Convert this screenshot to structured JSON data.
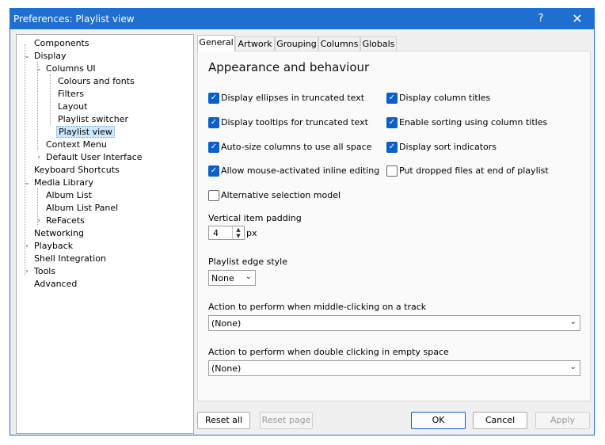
{
  "window": {
    "title": "Preferences: Playlist view",
    "help_glyph": "?",
    "close_glyph": "✕"
  },
  "tree": {
    "items": [
      {
        "label": "Components"
      },
      {
        "label": "Display",
        "expander": "⌄"
      },
      {
        "label": "Columns UI",
        "expander": "⌄"
      },
      {
        "label": "Colours and fonts"
      },
      {
        "label": "Filters"
      },
      {
        "label": "Layout"
      },
      {
        "label": "Playlist switcher"
      },
      {
        "label": "Playlist view",
        "selected": true
      },
      {
        "label": "Context Menu"
      },
      {
        "label": "Default User Interface",
        "expander": "›"
      },
      {
        "label": "Keyboard Shortcuts"
      },
      {
        "label": "Media Library",
        "expander": "⌄"
      },
      {
        "label": "Album List"
      },
      {
        "label": "Album List Panel"
      },
      {
        "label": "ReFacets",
        "expander": "›"
      },
      {
        "label": "Networking"
      },
      {
        "label": "Playback",
        "expander": "›"
      },
      {
        "label": "Shell Integration"
      },
      {
        "label": "Tools",
        "expander": "›"
      },
      {
        "label": "Advanced"
      }
    ]
  },
  "tabs": [
    "General",
    "Artwork",
    "Grouping",
    "Columns",
    "Globals"
  ],
  "panel": {
    "heading": "Appearance and behaviour",
    "checkboxes": {
      "ellipses": {
        "label": "Display ellipses in truncated text",
        "checked": true
      },
      "tooltips": {
        "label": "Display tooltips for truncated text",
        "checked": true
      },
      "autosize": {
        "label": "Auto-size columns to use all space",
        "checked": true
      },
      "inline_edit": {
        "label": "Allow mouse-activated inline editing",
        "checked": true
      },
      "alt_selection": {
        "label": "Alternative selection model",
        "checked": false
      },
      "column_titles": {
        "label": "Display column titles",
        "checked": true
      },
      "sorting": {
        "label": "Enable sorting using column titles",
        "checked": true
      },
      "sort_indicators": {
        "label": "Display sort indicators",
        "checked": true
      },
      "dropped_files": {
        "label": "Put dropped files at end of playlist",
        "checked": false
      }
    },
    "vertical_padding": {
      "label": "Vertical item padding",
      "value": "4",
      "unit": "px"
    },
    "edge_style": {
      "label": "Playlist edge style",
      "value": "None"
    },
    "middle_click": {
      "label": "Action to perform when middle-clicking on a track",
      "value": "(None)"
    },
    "double_click": {
      "label": "Action to perform when double clicking in empty space",
      "value": "(None)"
    }
  },
  "buttons": {
    "reset_all": "Reset all",
    "reset_page": "Reset page",
    "ok": "OK",
    "cancel": "Cancel",
    "apply": "Apply"
  },
  "colors": {
    "accent": "#1f6fd1",
    "checkbox": "#0a5fc8",
    "selection": "#cce8ff"
  },
  "icons": {
    "check": "✓",
    "up": "▲",
    "down": "▼",
    "chevron": "⌄"
  }
}
